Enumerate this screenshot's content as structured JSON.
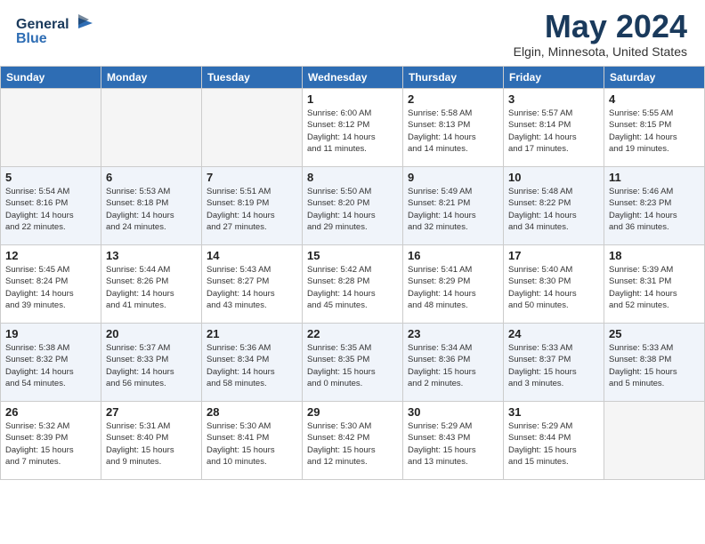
{
  "header": {
    "logo_line1": "General",
    "logo_line2": "Blue",
    "month_year": "May 2024",
    "location": "Elgin, Minnesota, United States"
  },
  "days_of_week": [
    "Sunday",
    "Monday",
    "Tuesday",
    "Wednesday",
    "Thursday",
    "Friday",
    "Saturday"
  ],
  "weeks": [
    [
      {
        "day": "",
        "info": ""
      },
      {
        "day": "",
        "info": ""
      },
      {
        "day": "",
        "info": ""
      },
      {
        "day": "1",
        "info": "Sunrise: 6:00 AM\nSunset: 8:12 PM\nDaylight: 14 hours\nand 11 minutes."
      },
      {
        "day": "2",
        "info": "Sunrise: 5:58 AM\nSunset: 8:13 PM\nDaylight: 14 hours\nand 14 minutes."
      },
      {
        "day": "3",
        "info": "Sunrise: 5:57 AM\nSunset: 8:14 PM\nDaylight: 14 hours\nand 17 minutes."
      },
      {
        "day": "4",
        "info": "Sunrise: 5:55 AM\nSunset: 8:15 PM\nDaylight: 14 hours\nand 19 minutes."
      }
    ],
    [
      {
        "day": "5",
        "info": "Sunrise: 5:54 AM\nSunset: 8:16 PM\nDaylight: 14 hours\nand 22 minutes."
      },
      {
        "day": "6",
        "info": "Sunrise: 5:53 AM\nSunset: 8:18 PM\nDaylight: 14 hours\nand 24 minutes."
      },
      {
        "day": "7",
        "info": "Sunrise: 5:51 AM\nSunset: 8:19 PM\nDaylight: 14 hours\nand 27 minutes."
      },
      {
        "day": "8",
        "info": "Sunrise: 5:50 AM\nSunset: 8:20 PM\nDaylight: 14 hours\nand 29 minutes."
      },
      {
        "day": "9",
        "info": "Sunrise: 5:49 AM\nSunset: 8:21 PM\nDaylight: 14 hours\nand 32 minutes."
      },
      {
        "day": "10",
        "info": "Sunrise: 5:48 AM\nSunset: 8:22 PM\nDaylight: 14 hours\nand 34 minutes."
      },
      {
        "day": "11",
        "info": "Sunrise: 5:46 AM\nSunset: 8:23 PM\nDaylight: 14 hours\nand 36 minutes."
      }
    ],
    [
      {
        "day": "12",
        "info": "Sunrise: 5:45 AM\nSunset: 8:24 PM\nDaylight: 14 hours\nand 39 minutes."
      },
      {
        "day": "13",
        "info": "Sunrise: 5:44 AM\nSunset: 8:26 PM\nDaylight: 14 hours\nand 41 minutes."
      },
      {
        "day": "14",
        "info": "Sunrise: 5:43 AM\nSunset: 8:27 PM\nDaylight: 14 hours\nand 43 minutes."
      },
      {
        "day": "15",
        "info": "Sunrise: 5:42 AM\nSunset: 8:28 PM\nDaylight: 14 hours\nand 45 minutes."
      },
      {
        "day": "16",
        "info": "Sunrise: 5:41 AM\nSunset: 8:29 PM\nDaylight: 14 hours\nand 48 minutes."
      },
      {
        "day": "17",
        "info": "Sunrise: 5:40 AM\nSunset: 8:30 PM\nDaylight: 14 hours\nand 50 minutes."
      },
      {
        "day": "18",
        "info": "Sunrise: 5:39 AM\nSunset: 8:31 PM\nDaylight: 14 hours\nand 52 minutes."
      }
    ],
    [
      {
        "day": "19",
        "info": "Sunrise: 5:38 AM\nSunset: 8:32 PM\nDaylight: 14 hours\nand 54 minutes."
      },
      {
        "day": "20",
        "info": "Sunrise: 5:37 AM\nSunset: 8:33 PM\nDaylight: 14 hours\nand 56 minutes."
      },
      {
        "day": "21",
        "info": "Sunrise: 5:36 AM\nSunset: 8:34 PM\nDaylight: 14 hours\nand 58 minutes."
      },
      {
        "day": "22",
        "info": "Sunrise: 5:35 AM\nSunset: 8:35 PM\nDaylight: 15 hours\nand 0 minutes."
      },
      {
        "day": "23",
        "info": "Sunrise: 5:34 AM\nSunset: 8:36 PM\nDaylight: 15 hours\nand 2 minutes."
      },
      {
        "day": "24",
        "info": "Sunrise: 5:33 AM\nSunset: 8:37 PM\nDaylight: 15 hours\nand 3 minutes."
      },
      {
        "day": "25",
        "info": "Sunrise: 5:33 AM\nSunset: 8:38 PM\nDaylight: 15 hours\nand 5 minutes."
      }
    ],
    [
      {
        "day": "26",
        "info": "Sunrise: 5:32 AM\nSunset: 8:39 PM\nDaylight: 15 hours\nand 7 minutes."
      },
      {
        "day": "27",
        "info": "Sunrise: 5:31 AM\nSunset: 8:40 PM\nDaylight: 15 hours\nand 9 minutes."
      },
      {
        "day": "28",
        "info": "Sunrise: 5:30 AM\nSunset: 8:41 PM\nDaylight: 15 hours\nand 10 minutes."
      },
      {
        "day": "29",
        "info": "Sunrise: 5:30 AM\nSunset: 8:42 PM\nDaylight: 15 hours\nand 12 minutes."
      },
      {
        "day": "30",
        "info": "Sunrise: 5:29 AM\nSunset: 8:43 PM\nDaylight: 15 hours\nand 13 minutes."
      },
      {
        "day": "31",
        "info": "Sunrise: 5:29 AM\nSunset: 8:44 PM\nDaylight: 15 hours\nand 15 minutes."
      },
      {
        "day": "",
        "info": ""
      }
    ]
  ]
}
